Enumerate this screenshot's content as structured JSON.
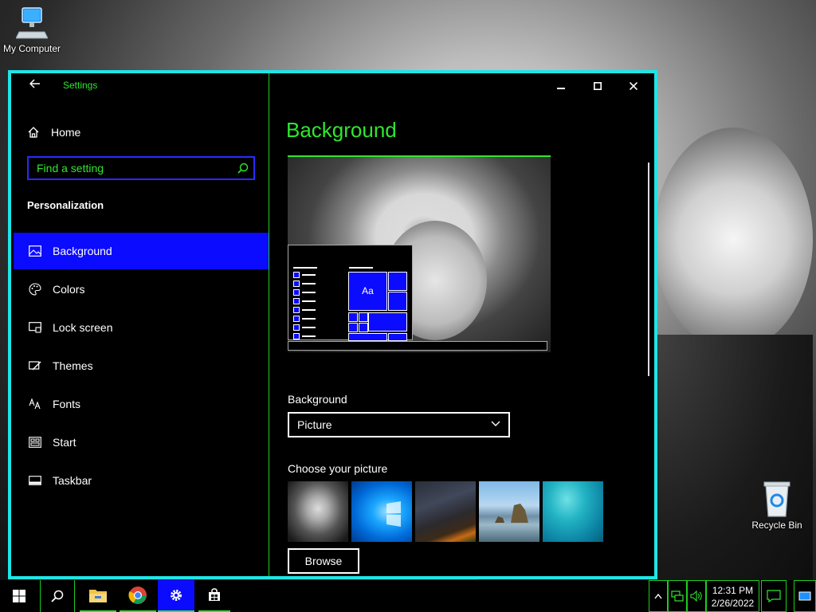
{
  "desktop": {
    "my_computer_label": "My Computer",
    "recycle_bin_label": "Recycle Bin"
  },
  "window": {
    "app_title": "Settings",
    "minimize_glyph": "—",
    "maximize_glyph": "☐",
    "close_glyph": "✕",
    "back_icon": "back-arrow-icon"
  },
  "sidebar": {
    "home_label": "Home",
    "search": {
      "placeholder": "Find a setting",
      "value": ""
    },
    "section_heading": "Personalization",
    "items": [
      {
        "label": "Background",
        "icon": "image-icon",
        "active": true
      },
      {
        "label": "Colors",
        "icon": "palette-icon",
        "active": false
      },
      {
        "label": "Lock screen",
        "icon": "lock-screen-icon",
        "active": false
      },
      {
        "label": "Themes",
        "icon": "themes-icon",
        "active": false
      },
      {
        "label": "Fonts",
        "icon": "fonts-icon",
        "active": false
      },
      {
        "label": "Start",
        "icon": "start-icon",
        "active": false
      },
      {
        "label": "Taskbar",
        "icon": "taskbar-icon",
        "active": false
      }
    ]
  },
  "content": {
    "page_title": "Background",
    "preview_tile_label": "Aa",
    "background_label": "Background",
    "background_value": "Picture",
    "choose_label": "Choose your picture",
    "browse_label": "Browse",
    "thumbnails": [
      "portrait",
      "windows-blue",
      "milky-way",
      "beach-rocks",
      "underwater-swimmer"
    ]
  },
  "taskbar": {
    "apps": [
      "start-icon",
      "search-icon",
      "file-explorer-icon",
      "chrome-icon",
      "settings-icon",
      "store-icon"
    ],
    "clock_time": "12:31 PM",
    "clock_date": "2/26/2022"
  },
  "colors": {
    "accent_green": "#2fe62f",
    "accent_blue": "#0b0bff",
    "window_border": "#1ee6e6"
  }
}
